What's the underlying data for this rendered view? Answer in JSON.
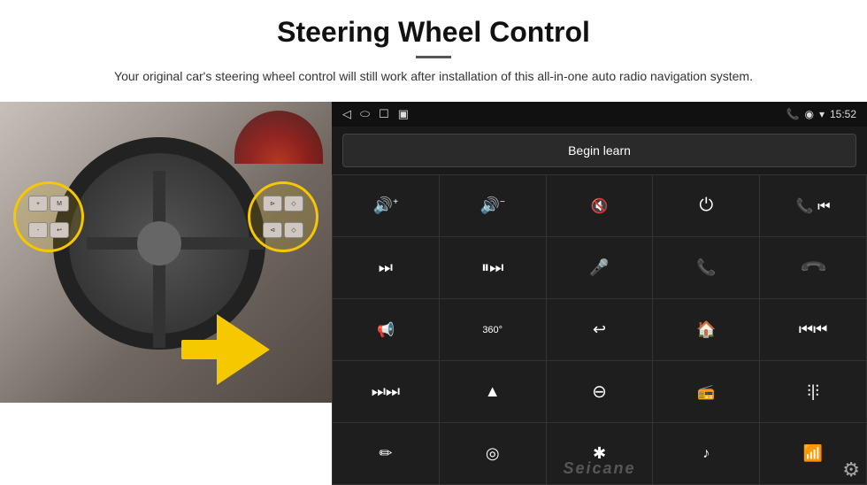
{
  "header": {
    "title": "Steering Wheel Control",
    "subtitle": "Your original car's steering wheel control will still work after installation of this all-in-one auto radio navigation system."
  },
  "status_bar": {
    "back_icon": "◁",
    "home_oval": "⬭",
    "square_icon": "☐",
    "signal_icon": "▣",
    "phone_icon": "📞",
    "location_icon": "◉",
    "wifi_icon": "▾",
    "time": "15:52"
  },
  "begin_learn": {
    "label": "Begin learn"
  },
  "controls": [
    {
      "icon": "🔊+",
      "name": "vol-up"
    },
    {
      "icon": "🔊-",
      "name": "vol-down"
    },
    {
      "icon": "🔇",
      "name": "mute"
    },
    {
      "icon": "⏻",
      "name": "power"
    },
    {
      "icon": "📞⏮",
      "name": "phone-prev"
    },
    {
      "icon": "⏭",
      "name": "next-track"
    },
    {
      "icon": "⏸⏭",
      "name": "pause-next"
    },
    {
      "icon": "🎤",
      "name": "mic"
    },
    {
      "icon": "📞",
      "name": "phone"
    },
    {
      "icon": "↩",
      "name": "hang-up"
    },
    {
      "icon": "📢",
      "name": "speaker"
    },
    {
      "icon": "360°",
      "name": "360-cam"
    },
    {
      "icon": "↩",
      "name": "back"
    },
    {
      "icon": "🏠",
      "name": "home"
    },
    {
      "icon": "⏮⏮",
      "name": "prev-track"
    },
    {
      "icon": "⏭⏭",
      "name": "fast-forward"
    },
    {
      "icon": "▲",
      "name": "nav"
    },
    {
      "icon": "⏺",
      "name": "source"
    },
    {
      "icon": "📻",
      "name": "radio"
    },
    {
      "icon": "≡≡",
      "name": "eq"
    },
    {
      "icon": "✏",
      "name": "custom-1"
    },
    {
      "icon": "◉",
      "name": "custom-2"
    },
    {
      "icon": "✱",
      "name": "bluetooth"
    },
    {
      "icon": "♪",
      "name": "music"
    },
    {
      "icon": "📶",
      "name": "signal-bar"
    }
  ],
  "watermark": "Seicane",
  "gear_icon": "⚙"
}
